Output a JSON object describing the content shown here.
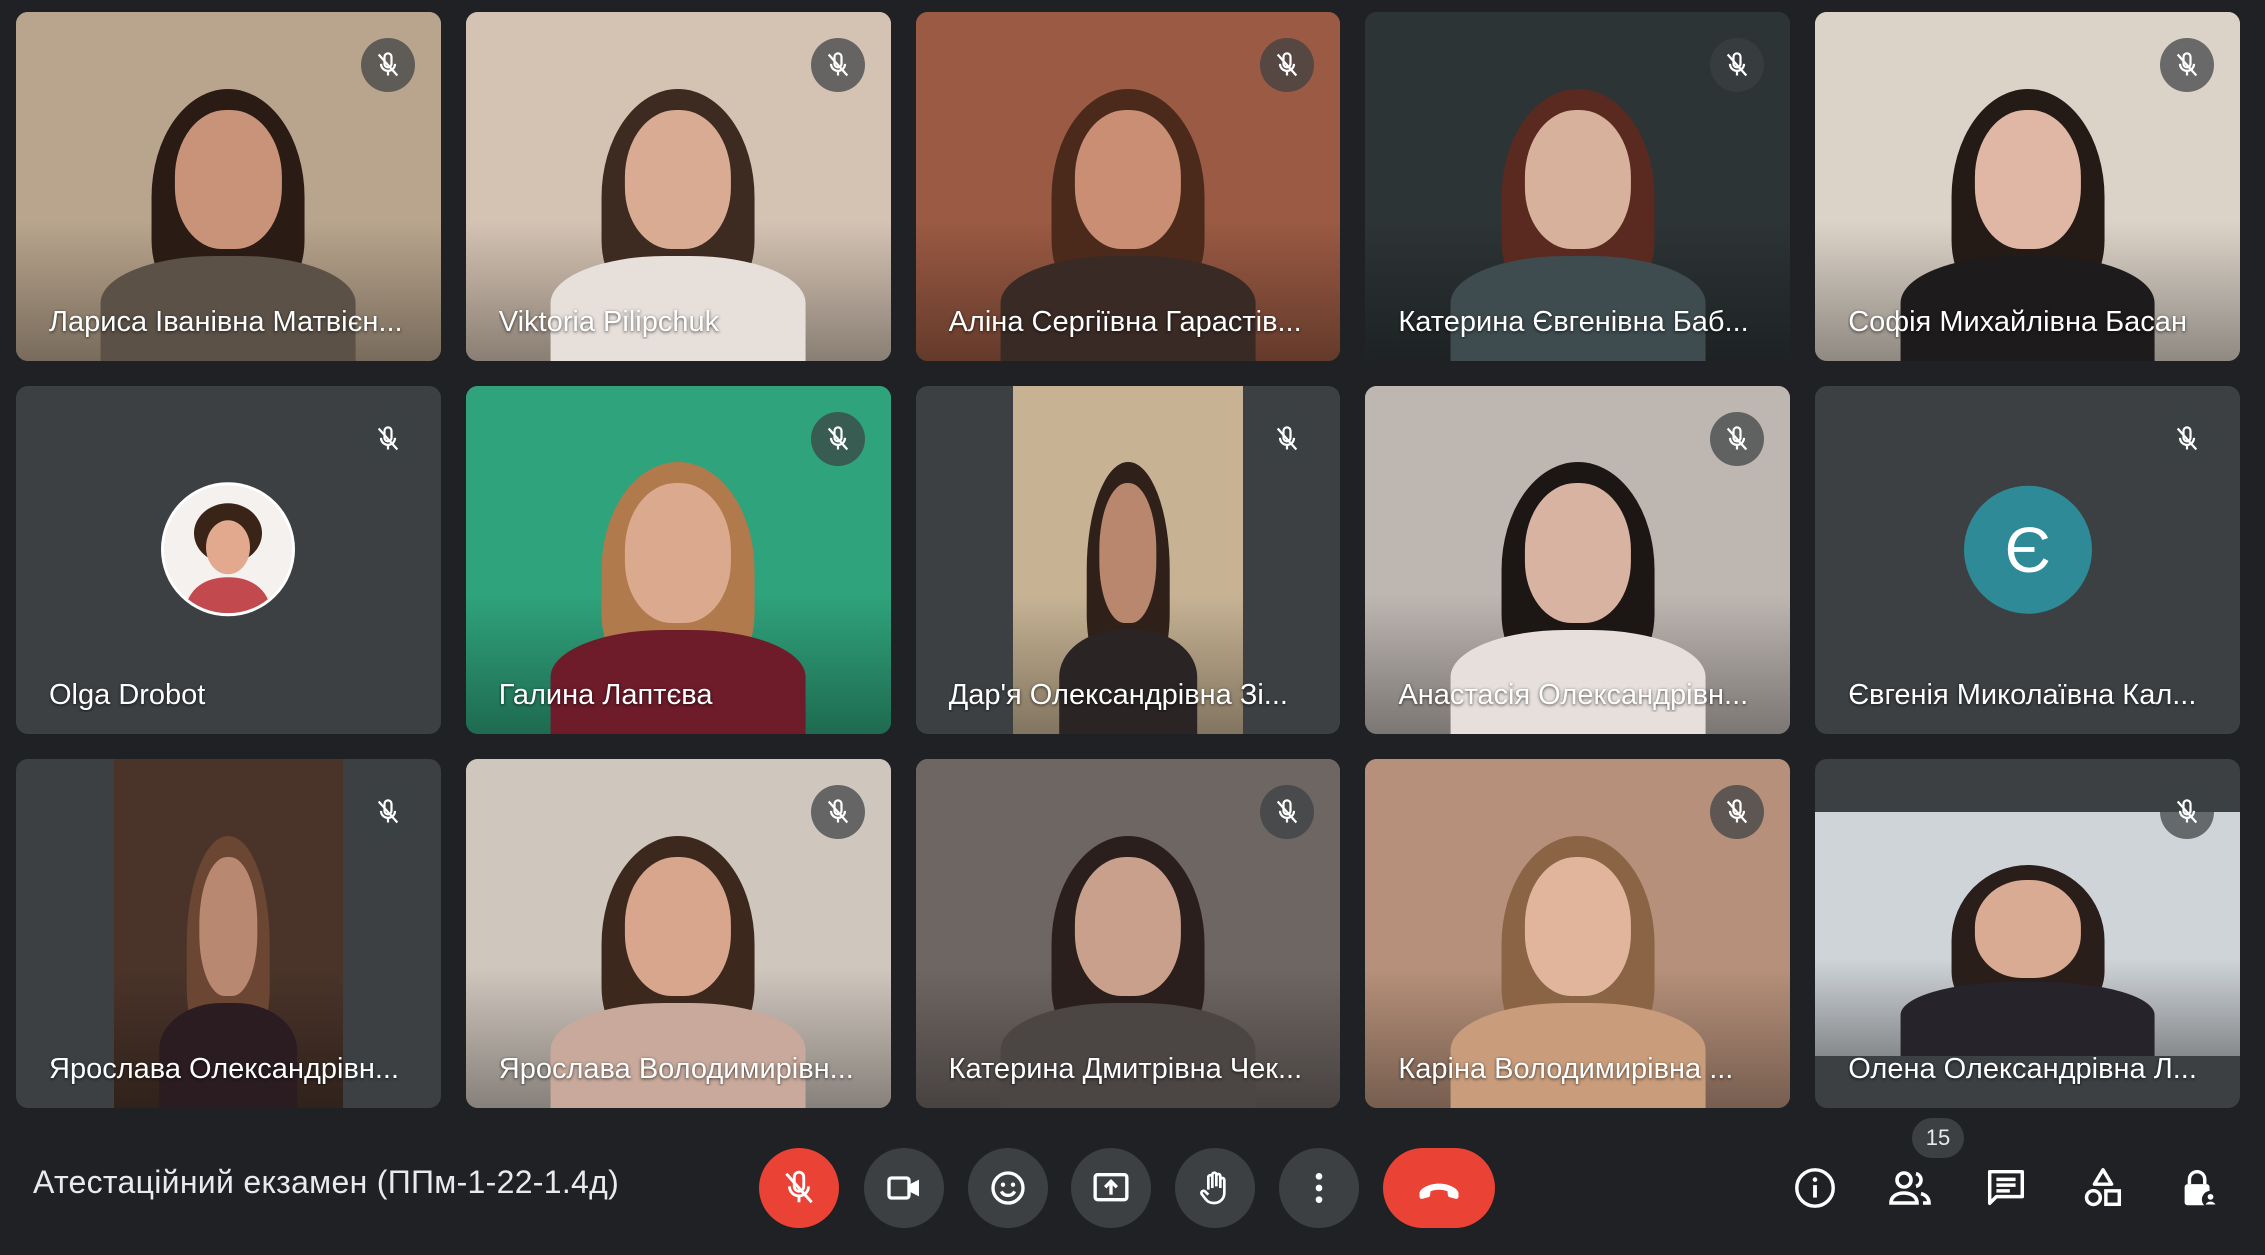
{
  "participants": [
    {
      "name": "Лариса Іванівна Матвієн...",
      "bg": "#b9a58d",
      "skin": "#c9937a",
      "hair": "#2a1c15",
      "shirt": "#5b5147",
      "kind": "video"
    },
    {
      "name": "Viktoria Pilipchuk",
      "bg": "#d4c3b3",
      "skin": "#d9ab92",
      "hair": "#3d2a20",
      "shirt": "#e7dfda",
      "kind": "video"
    },
    {
      "name": "Аліна Сергіївна Гарастів...",
      "bg": "#9a5a43",
      "skin": "#c98e74",
      "hair": "#4b2a1c",
      "shirt": "#3a2a25",
      "kind": "video"
    },
    {
      "name": "Катерина Євгенівна Баб...",
      "bg": "#2d3436",
      "skin": "#d7b19c",
      "hair": "#5a2a20",
      "shirt": "#3e4c4f",
      "kind": "video"
    },
    {
      "name": "Софія Михайлівна Басан",
      "bg": "#dcd3c8",
      "skin": "#e0b7a4",
      "hair": "#241a16",
      "shirt": "#1e1b1c",
      "kind": "video"
    },
    {
      "name": "Olga Drobot",
      "kind": "photo-avatar"
    },
    {
      "name": "Галина Лаптєва",
      "bg": "#2fa37b",
      "skin": "#dba98d",
      "hair": "#b07a4c",
      "shirt": "#6e1b2a",
      "kind": "video"
    },
    {
      "name": "Дар'я Олександрівна Зі...",
      "bg": "#c7b394",
      "skin": "#b9876e",
      "hair": "#2f211a",
      "shirt": "#2a2524",
      "kind": "video-narrow"
    },
    {
      "name": "Анастасія Олександрівн...",
      "bg": "#bdb6b1",
      "skin": "#d9b3a2",
      "hair": "#1c1615",
      "shirt": "#e6dfdc",
      "kind": "video"
    },
    {
      "name": "Євгенія Миколаївна Кал...",
      "kind": "letter-avatar",
      "letter": "Є"
    },
    {
      "name": "Ярослава Олександрівн...",
      "bg": "#4a342a",
      "skin": "#b88870",
      "hair": "#6b4632",
      "shirt": "#2b1c22",
      "kind": "video-narrow"
    },
    {
      "name": "Ярослава Володимирівн...",
      "bg": "#cfc6bd",
      "skin": "#d8a58d",
      "hair": "#3c281d",
      "shirt": "#c8a99b",
      "kind": "video"
    },
    {
      "name": "Катерина Дмитрівна Чек...",
      "bg": "#6e6663",
      "skin": "#c9a08b",
      "hair": "#2a1f1c",
      "shirt": "#4b4544",
      "kind": "video"
    },
    {
      "name": "Каріна Володимирівна ...",
      "bg": "#b6907a",
      "skin": "#e0b59c",
      "hair": "#8a6444",
      "shirt": "#c99d7c",
      "kind": "video"
    },
    {
      "name": "Олена Олександрівна Л...",
      "bg": "#cfd4d8",
      "skin": "#d9ab92",
      "hair": "#2a1e1b",
      "shirt": "#26232a",
      "kind": "video-letterbox"
    }
  ],
  "meeting": {
    "title": "Атестаційний екзамен (ППм-1-22-1.4д)"
  },
  "people_count": "15",
  "colors": {
    "background": "#202124",
    "tile": "#3c4043",
    "danger": "#ea4335",
    "avatar": "#2f8a98"
  },
  "controls": [
    {
      "name": "mic-off-button",
      "icon": "mic-off-icon",
      "style": "red"
    },
    {
      "name": "camera-button",
      "icon": "camera-icon",
      "style": "dark"
    },
    {
      "name": "reactions-button",
      "icon": "emoji-icon",
      "style": "dark"
    },
    {
      "name": "present-button",
      "icon": "present-icon",
      "style": "dark"
    },
    {
      "name": "raise-hand-button",
      "icon": "hand-icon",
      "style": "dark"
    },
    {
      "name": "more-options-button",
      "icon": "more-vert-icon",
      "style": "dark"
    }
  ],
  "side_icons": [
    "info-icon",
    "people-icon",
    "chat-icon",
    "activities-icon",
    "host-controls-icon"
  ]
}
